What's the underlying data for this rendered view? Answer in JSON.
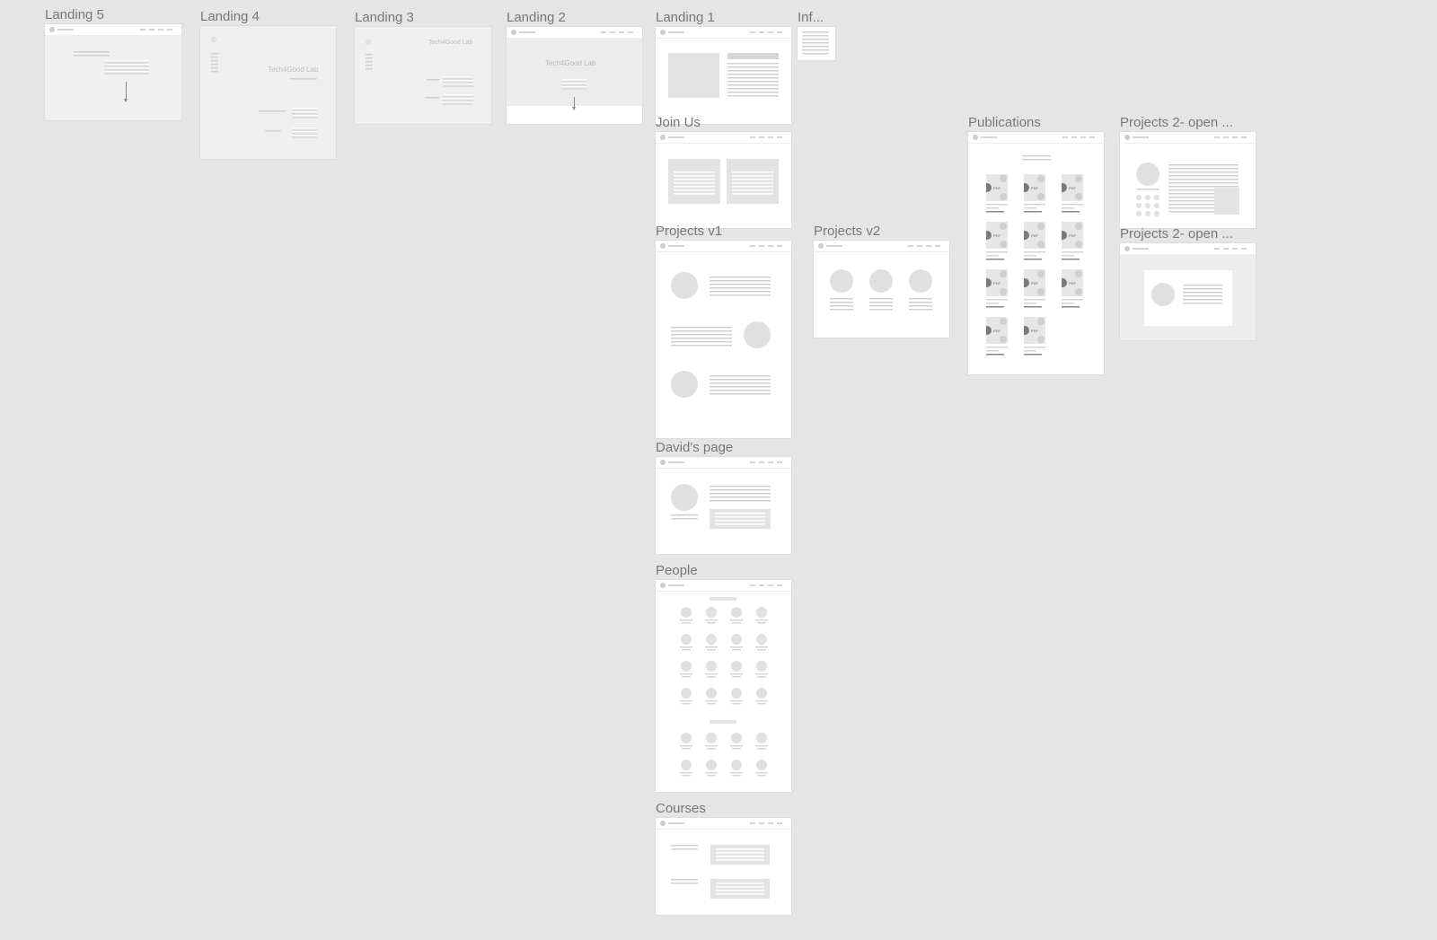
{
  "canvas": {
    "background": "#e5e5e5"
  },
  "frames": {
    "landing5": {
      "label": "Landing 5"
    },
    "landing4": {
      "label": "Landing 4",
      "hero": "Tech4Good Lab"
    },
    "landing3": {
      "label": "Landing 3",
      "hero": "Tech4Good Lab"
    },
    "landing2": {
      "label": "Landing 2",
      "hero": "Tech4Good Lab"
    },
    "landing1": {
      "label": "Landing 1"
    },
    "info": {
      "label": "Inf..."
    },
    "join_us": {
      "label": "Join Us"
    },
    "publications": {
      "label": "Publications",
      "pdf_text": "PDF"
    },
    "projects2_open_a": {
      "label": "Projects 2- open ..."
    },
    "projects2_open_b": {
      "label": "Projects 2- open ..."
    },
    "projects_v1": {
      "label": "Projects v1"
    },
    "projects_v2": {
      "label": "Projects v2"
    },
    "davids_page": {
      "label": "David's page"
    },
    "people": {
      "label": "People"
    },
    "courses": {
      "label": "Courses"
    }
  }
}
